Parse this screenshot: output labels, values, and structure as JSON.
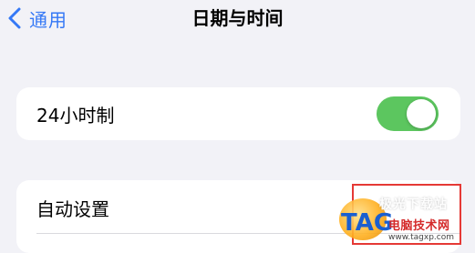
{
  "nav": {
    "back_label": "通用",
    "title": "日期与时间"
  },
  "settings": {
    "hour_24": {
      "label": "24小时制",
      "enabled": true
    },
    "auto_set": {
      "label": "自动设置"
    }
  },
  "colors": {
    "accent": "#3478f6",
    "toggle_on": "#5cc65f",
    "background": "#f2f2f7",
    "highlight": "#e53935"
  },
  "watermark": {
    "logo_text": "TAG",
    "line1": "极光下载站",
    "line2": "电脑技术网",
    "url": "www.tagxp.com"
  }
}
